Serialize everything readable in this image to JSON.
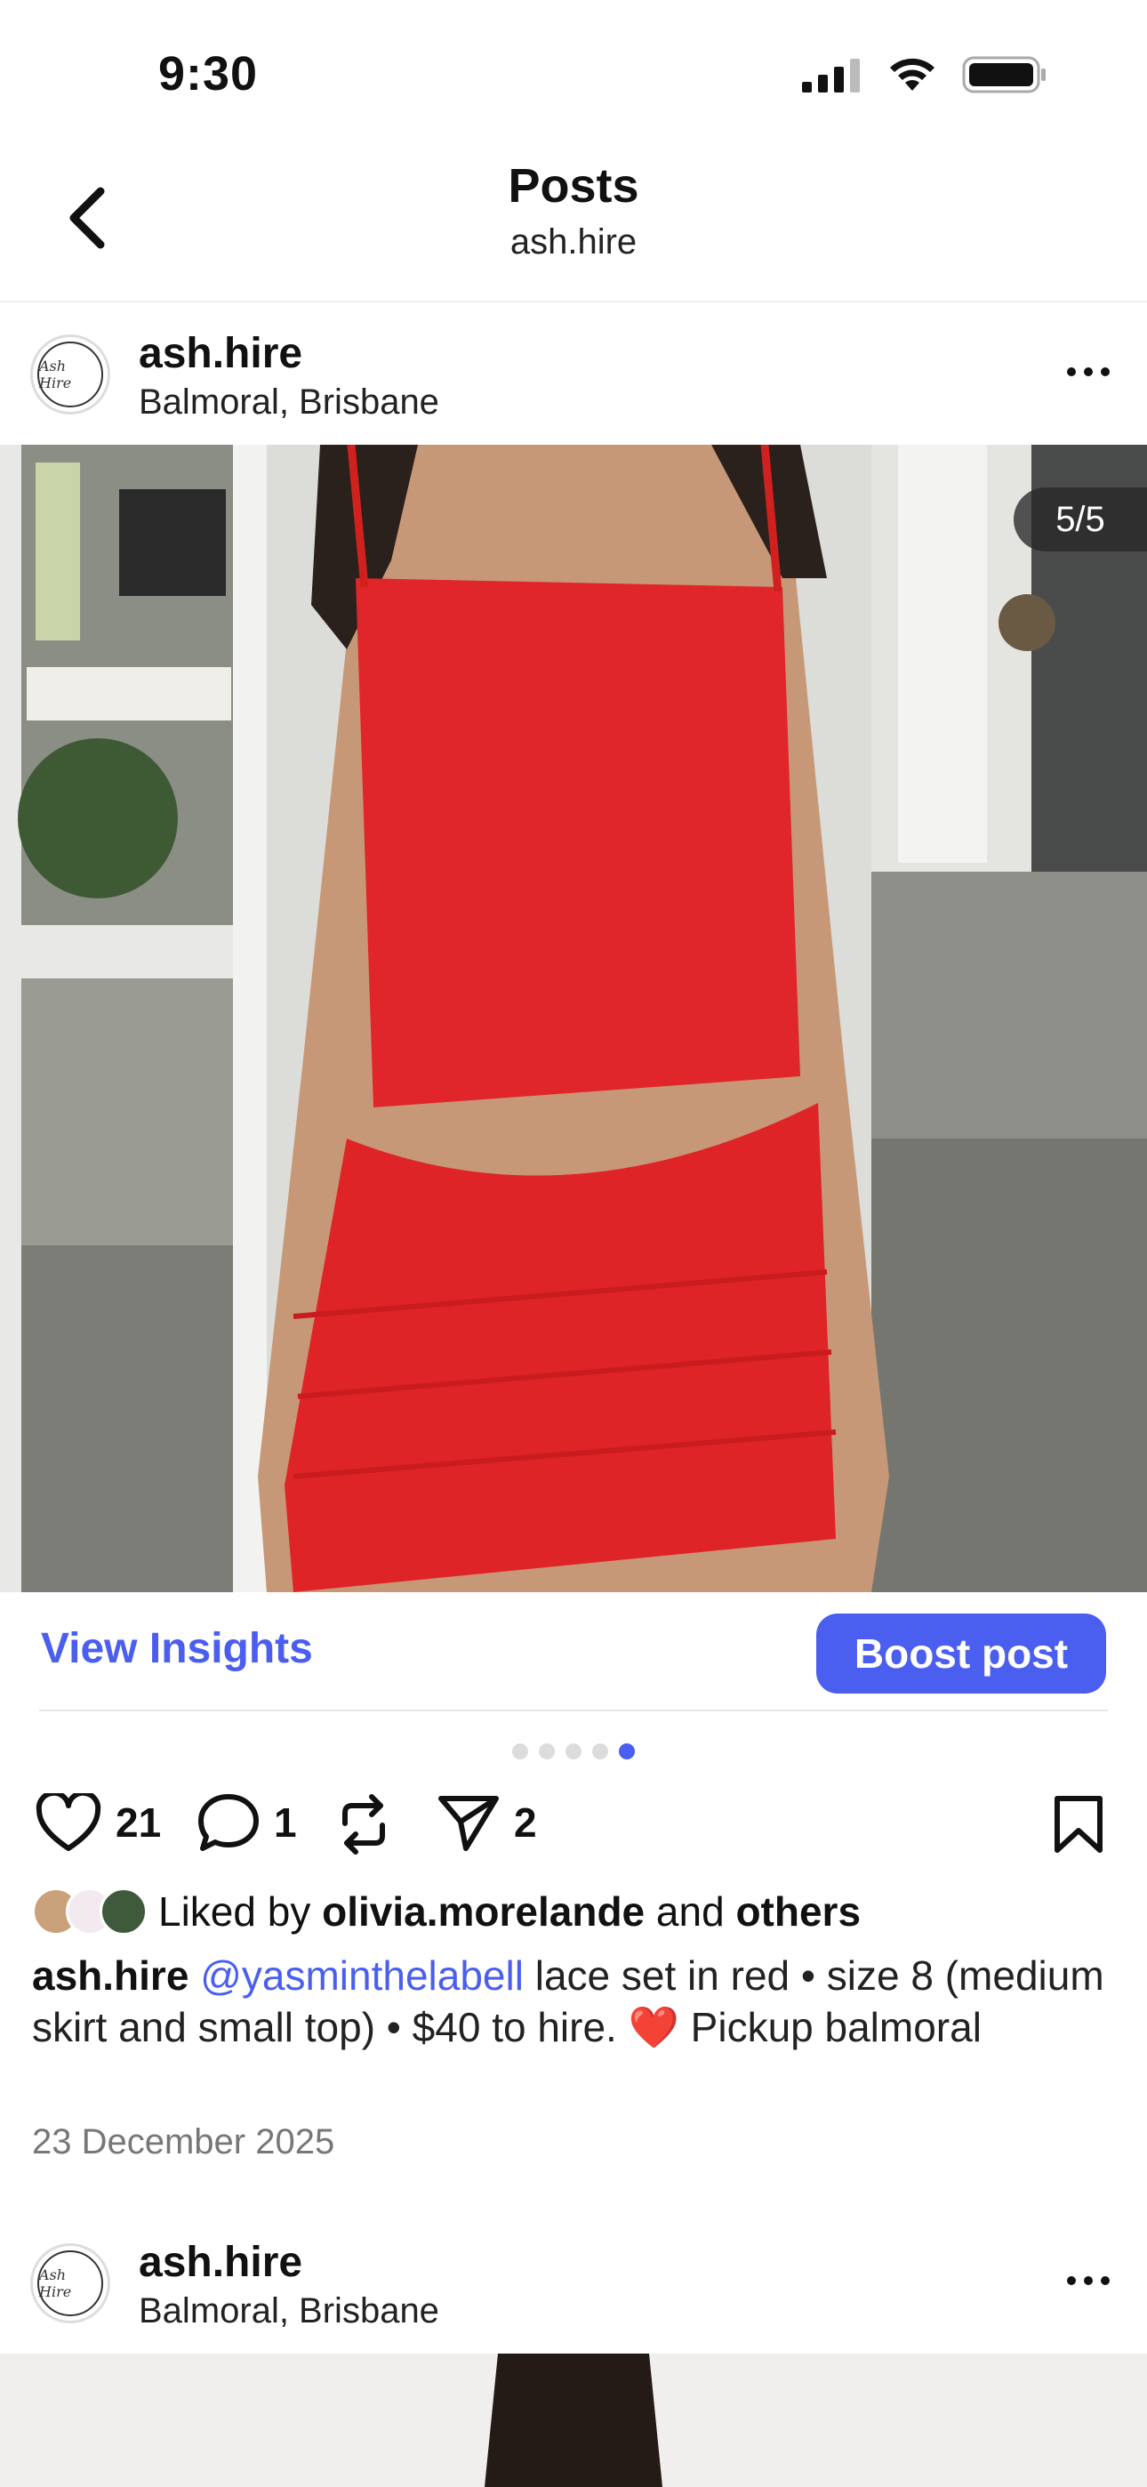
{
  "status_bar": {
    "time": "9:30"
  },
  "header": {
    "title": "Posts",
    "subtitle": "ash.hire"
  },
  "posts": [
    {
      "avatar_text": "Ash Hire",
      "username": "ash.hire",
      "location": "Balmoral, Brisbane",
      "image_counter": "5/5",
      "insights_label": "View Insights",
      "boost_label": "Boost post",
      "carousel": {
        "total": 5,
        "active": 5
      },
      "likes": "21",
      "comments": "1",
      "shares": "2",
      "liked_by_prefix": "Liked by",
      "liked_by_user": "olivia.morelande",
      "liked_by_and": "and",
      "liked_by_others": "others",
      "caption_user": "ash.hire",
      "caption_mention": "@yasminthelabell",
      "caption_text": " lace set in red • size 8 (medium skirt and small top) • $40 to hire. ❤️ Pickup balmoral",
      "date": "23 December 2025"
    },
    {
      "avatar_text": "Ash Hire",
      "username": "ash.hire",
      "location": "Balmoral, Brisbane"
    }
  ],
  "colors": {
    "accent": "#4a5ef0",
    "dress_red": "#e0262a"
  }
}
